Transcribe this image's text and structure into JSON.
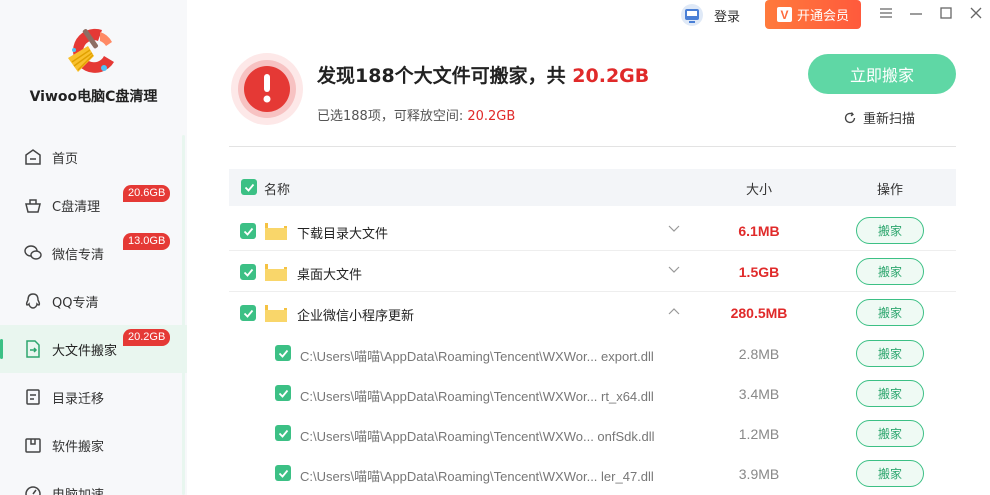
{
  "app": {
    "name": "Viwoo电脑C盘清理"
  },
  "titlebar": {
    "login_label": "登录",
    "vip_icon": "V",
    "vip_label": "开通会员",
    "menu_icon": "menu-icon",
    "minimize_icon": "minimize-icon",
    "maximize_icon": "maximize-icon",
    "close_icon": "close-icon"
  },
  "sidebar": {
    "items": [
      {
        "label": "首页",
        "icon": "home-icon",
        "badge": ""
      },
      {
        "label": "C盘清理",
        "icon": "broom-basket-icon",
        "badge": "20.6GB"
      },
      {
        "label": "微信专清",
        "icon": "wechat-icon",
        "badge": "13.0GB"
      },
      {
        "label": "QQ专清",
        "icon": "qq-icon",
        "badge": ""
      },
      {
        "label": "大文件搬家",
        "icon": "file-move-icon",
        "badge": "20.2GB",
        "active": true
      },
      {
        "label": "目录迁移",
        "icon": "directory-icon",
        "badge": ""
      },
      {
        "label": "软件搬家",
        "icon": "software-box-icon",
        "badge": ""
      },
      {
        "label": "电脑加速",
        "icon": "speed-icon",
        "badge": ""
      }
    ]
  },
  "summary": {
    "title_prefix": "发现188个大文件可搬家，共",
    "title_size": "20.2GB",
    "subtitle_prefix": "已选188项，可释放空间:",
    "subtitle_size": "20.2GB",
    "move_now_label": "立即搬家",
    "rescan_label": "重新扫描"
  },
  "table": {
    "headers": {
      "name": "名称",
      "size": "大小",
      "action": "操作"
    },
    "groups": [
      {
        "name": "下载目录大文件",
        "size": "6.1MB",
        "expanded": false,
        "action": "搬家"
      },
      {
        "name": "桌面大文件",
        "size": "1.5GB",
        "expanded": false,
        "action": "搬家"
      },
      {
        "name": "企业微信小程序更新",
        "size": "280.5MB",
        "expanded": true,
        "action": "搬家"
      }
    ],
    "files": [
      {
        "path": "C:\\Users\\喵喵\\AppData\\Roaming\\Tencent\\WXWor... export.dll",
        "size": "2.8MB",
        "action": "搬家"
      },
      {
        "path": "C:\\Users\\喵喵\\AppData\\Roaming\\Tencent\\WXWor... rt_x64.dll",
        "size": "3.4MB",
        "action": "搬家"
      },
      {
        "path": "C:\\Users\\喵喵\\AppData\\Roaming\\Tencent\\WXWo... onfSdk.dll",
        "size": "1.2MB",
        "action": "搬家"
      },
      {
        "path": "C:\\Users\\喵喵\\AppData\\Roaming\\Tencent\\WXWor... ler_47.dll",
        "size": "3.9MB",
        "action": "搬家"
      }
    ]
  },
  "colors": {
    "accent_green": "#3cc085",
    "primary_button": "#5fd7a5",
    "alert_red": "#e02a2a",
    "vip_orange": "#ff6a3c"
  }
}
